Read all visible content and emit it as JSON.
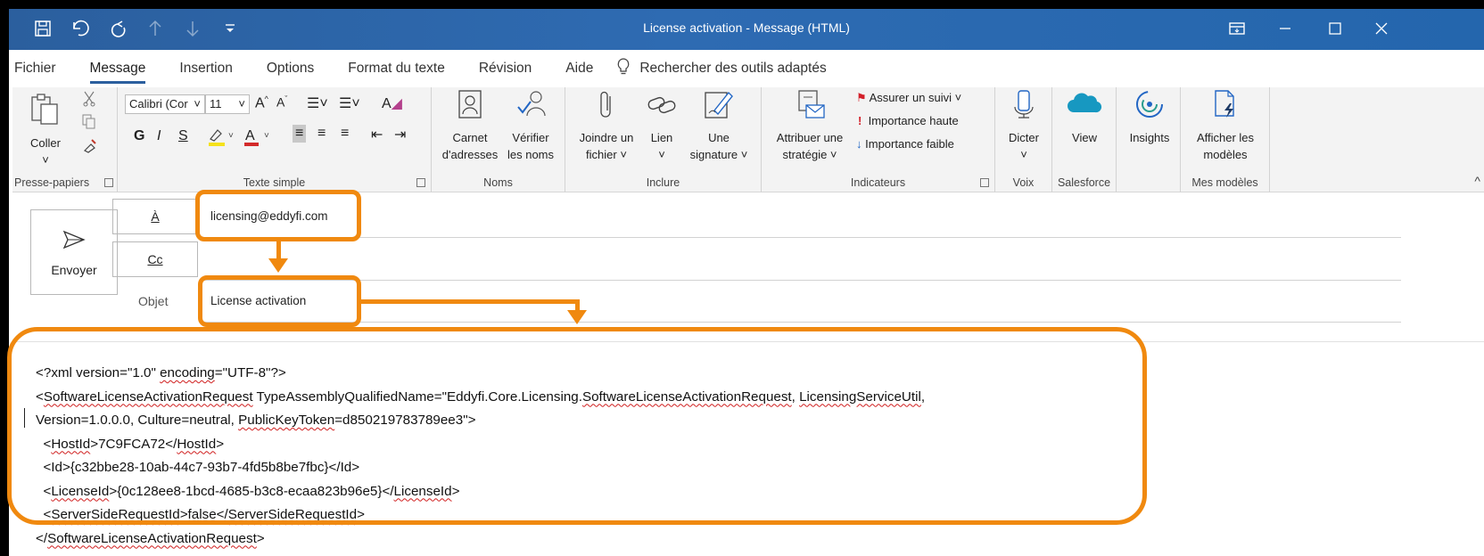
{
  "window": {
    "title": "License activation  -  Message (HTML)"
  },
  "qat": {
    "icons": [
      "save-icon",
      "undo-icon",
      "redo-icon",
      "up-arrow-icon",
      "down-arrow-icon",
      "customize-icon"
    ]
  },
  "menu": {
    "items": [
      "Fichier",
      "Message",
      "Insertion",
      "Options",
      "Format du texte",
      "Révision",
      "Aide"
    ],
    "active": "Message",
    "search": "Rechercher des outils adaptés"
  },
  "ribbon": {
    "clipboard": {
      "paste": "Coller",
      "label": "Presse-papiers"
    },
    "text": {
      "font": "Calibri (Cor",
      "size": "11",
      "bold": "G",
      "italic": "I",
      "underline": "S",
      "label": "Texte simple"
    },
    "names": {
      "address_book_l1": "Carnet",
      "address_book_l2": "d'adresses",
      "check_names_l1": "Vérifier",
      "check_names_l2": "les noms",
      "label": "Noms"
    },
    "include": {
      "attach_l1": "Joindre un",
      "attach_l2": "fichier ˅",
      "link_l1": "Lien",
      "link_l2": "˅",
      "signature_l1": "Une",
      "signature_l2": "signature ˅",
      "label": "Inclure"
    },
    "tags": {
      "policy_l1": "Attribuer une",
      "policy_l2": "stratégie ˅",
      "follow_up": "Assurer un suivi ˅",
      "high": "Importance haute",
      "low": "Importance faible",
      "label": "Indicateurs"
    },
    "voice": {
      "dictate": "Dicter",
      "dictate_caret": "˅",
      "label": "Voix"
    },
    "salesforce": {
      "view": "View",
      "label": "Salesforce"
    },
    "insights": {
      "insights": "Insights"
    },
    "templates": {
      "view_l1": "Afficher les",
      "view_l2": "modèles",
      "label": "Mes modèles"
    }
  },
  "compose": {
    "send": "Envoyer",
    "to_label": "À",
    "cc_label": "Cc",
    "subject_label": "Objet",
    "to_value": "licensing@eddyfi.com",
    "subject_value": "License activation"
  },
  "body": {
    "lines": [
      "<?xml version=\"1.0\" encoding=\"UTF-8\"?>",
      "<SoftwareLicenseActivationRequest TypeAssemblyQualifiedName=\"Eddyfi.Core.Licensing.SoftwareLicenseActivationRequest, LicensingServiceUtil,",
      "Version=1.0.0.0, Culture=neutral, PublicKeyToken=d850219783789ee3\">",
      "  <HostId>7C9FCA72</HostId>",
      "  <Id>{c32bbe28-10ab-44c7-93b7-4fd5b8be7fbc}</Id>",
      "  <LicenseId>{0c128ee8-1bcd-4685-b3c8-ecaa823b96e5}</LicenseId>",
      "  <ServerSideRequestId>false</ServerSideRequestId>",
      "</SoftwareLicenseActivationRequest>"
    ]
  },
  "colors": {
    "titlebar": "#2b5f9e",
    "annotation": "#f0890f",
    "spellcheck": "#d01e1e"
  }
}
